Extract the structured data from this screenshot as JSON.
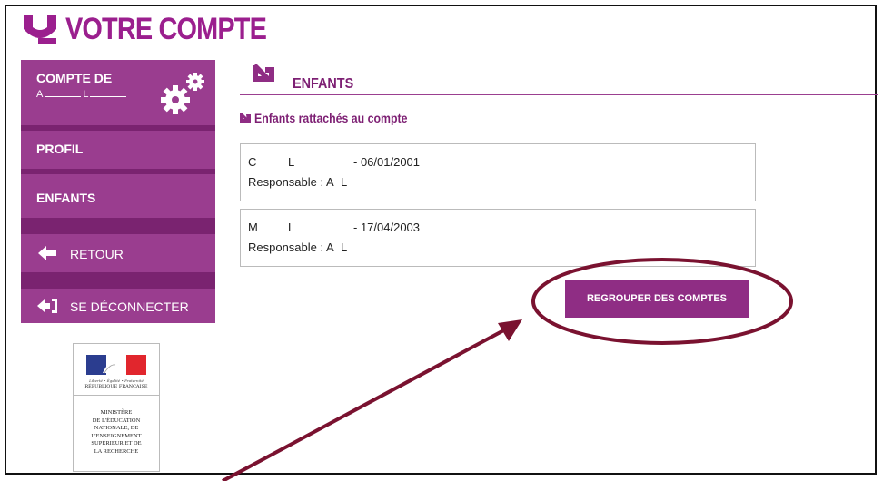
{
  "header": {
    "title": "VOTRE COMPTE",
    "logo_icon": "arrow-swoosh-logo-icon"
  },
  "sidebar": {
    "account_label": "COMPTE DE",
    "account_name_first": "A",
    "account_name_last": "L",
    "items": [
      {
        "label": "PROFIL"
      },
      {
        "label": "ENFANTS"
      },
      {
        "label": "RETOUR",
        "icon": "arrow-left-icon"
      },
      {
        "label": "SE DÉCONNECTER",
        "icon": "logout-icon"
      }
    ]
  },
  "ministry": {
    "motto": "Liberté • Égalité • Fraternité",
    "republic": "RÉPUBLIQUE FRANÇAISE",
    "name": "MINISTÈRE\nDE L'ÉDUCATION\nNATIONALE, DE\nL'ENSEIGNEMENT\nSUPÉRIEUR ET DE\nLA RECHERCHE"
  },
  "main": {
    "title": "ENFANTS",
    "subtitle": "Enfants rattachés au compte",
    "children": [
      {
        "first": "C",
        "last": "L",
        "birth": "- 06/01/2001",
        "resp_label": "Responsable : A",
        "resp_last": "L"
      },
      {
        "first": "M",
        "last": "L",
        "birth": "- 17/04/2003",
        "resp_label": "Responsable : A",
        "resp_last": "L"
      }
    ],
    "regroup_button": "REGROUPER DES COMPTES"
  },
  "colors": {
    "brand": "#9b1f8e",
    "sidebar": "#8f2d84",
    "annotation": "#7a1230"
  }
}
